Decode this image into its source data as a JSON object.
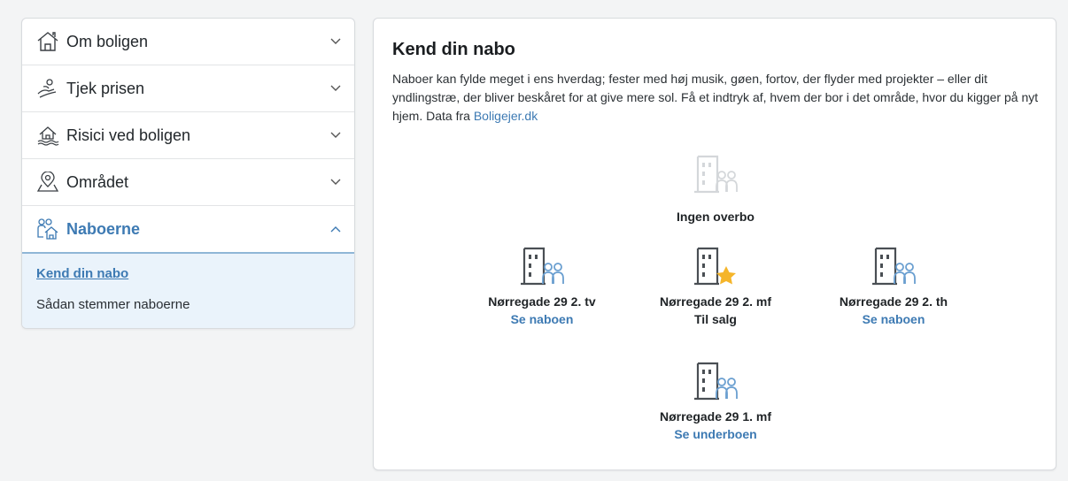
{
  "sidebar": {
    "items": [
      {
        "label": "Om boligen",
        "icon": "house-icon"
      },
      {
        "label": "Tjek prisen",
        "icon": "price-hand-icon"
      },
      {
        "label": "Risici ved boligen",
        "icon": "flood-house-icon"
      },
      {
        "label": "Området",
        "icon": "map-pin-icon"
      },
      {
        "label": "Naboerne",
        "icon": "neighbors-icon"
      }
    ],
    "submenu": {
      "active_link": "Kend din nabo",
      "other_item": "Sådan stemmer naboerne"
    }
  },
  "main": {
    "title": "Kend din nabo",
    "description": "Naboer kan fylde meget i ens hverdag; fester med høj musik, gøen, fortov, der flyder med projekter – eller dit yndlingstræ, der bliver beskåret for at give mere sol. Få et indtryk af, hvem der bor i det område, hvor du kigger på nyt hjem. Data fra ",
    "source_link": "Boligejer.dk",
    "units": {
      "above": {
        "label": "Ingen overbo"
      },
      "left": {
        "address": "Nørregade 29 2. tv",
        "action": "Se naboen"
      },
      "center": {
        "address": "Nørregade 29 2. mf",
        "status": "Til salg"
      },
      "right": {
        "address": "Nørregade 29 2. th",
        "action": "Se naboen"
      },
      "below": {
        "address": "Nørregade 29 1. mf",
        "action": "Se underboen"
      }
    }
  },
  "colors": {
    "accent": "#3d7ab3",
    "star": "#f5b52a",
    "people": "#6a9fd0",
    "building": "#4a4f54"
  }
}
